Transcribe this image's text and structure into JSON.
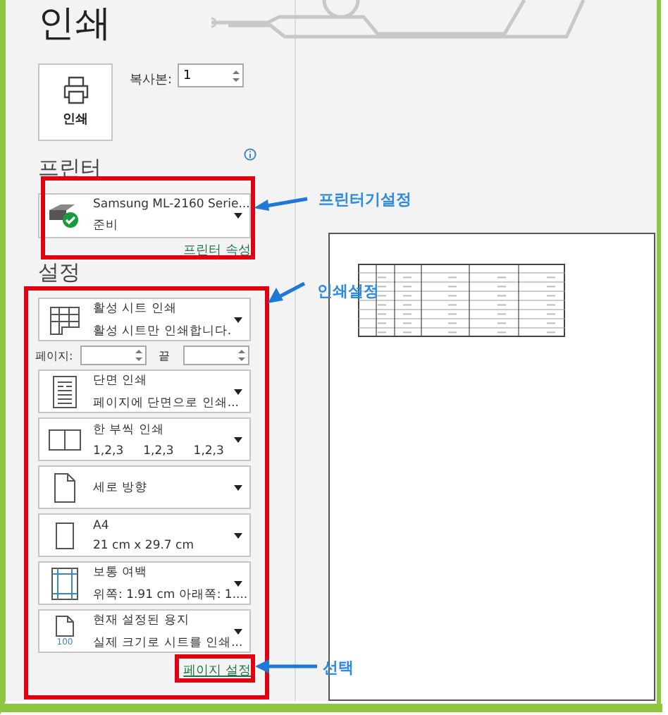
{
  "title": "인쇄",
  "print_button": {
    "label": "인쇄"
  },
  "copies": {
    "label": "복사본:",
    "value": "1"
  },
  "printer": {
    "heading": "프린터",
    "name": "Samsung ML-2160 Serie...",
    "status": "준비",
    "properties_link": "프린터 속성"
  },
  "settings": {
    "heading": "설정",
    "options": [
      {
        "kind": "sheet",
        "title": "활성 시트 인쇄",
        "subtitle": "활성 시트만 인쇄합니다."
      },
      {
        "kind": "pages",
        "label": "페이지:",
        "to_label": "끝"
      },
      {
        "kind": "sides",
        "title": "단면 인쇄",
        "subtitle": "페이지에 단면으로 인쇄..."
      },
      {
        "kind": "collate",
        "title": "한 부씩 인쇄",
        "parts": [
          "1,2,3",
          "1,2,3",
          "1,2,3"
        ]
      },
      {
        "kind": "orientation",
        "title": "세로 방향"
      },
      {
        "kind": "paper",
        "title": "A4",
        "subtitle": "21 cm x 29.7 cm"
      },
      {
        "kind": "margins",
        "title": "보통 여백",
        "subtitle": "위쪽: 1.91 cm 아래쪽: 1...."
      },
      {
        "kind": "scaling",
        "title": "현재 설정된 용지",
        "subtitle": "실제 크기로 시트를 인쇄...",
        "icon_text": "100"
      }
    ],
    "page_setup_link": "페이지 설정"
  },
  "annotations": [
    {
      "label": "프린터기설정"
    },
    {
      "label": "인쇄설정"
    },
    {
      "label": "선택"
    }
  ]
}
